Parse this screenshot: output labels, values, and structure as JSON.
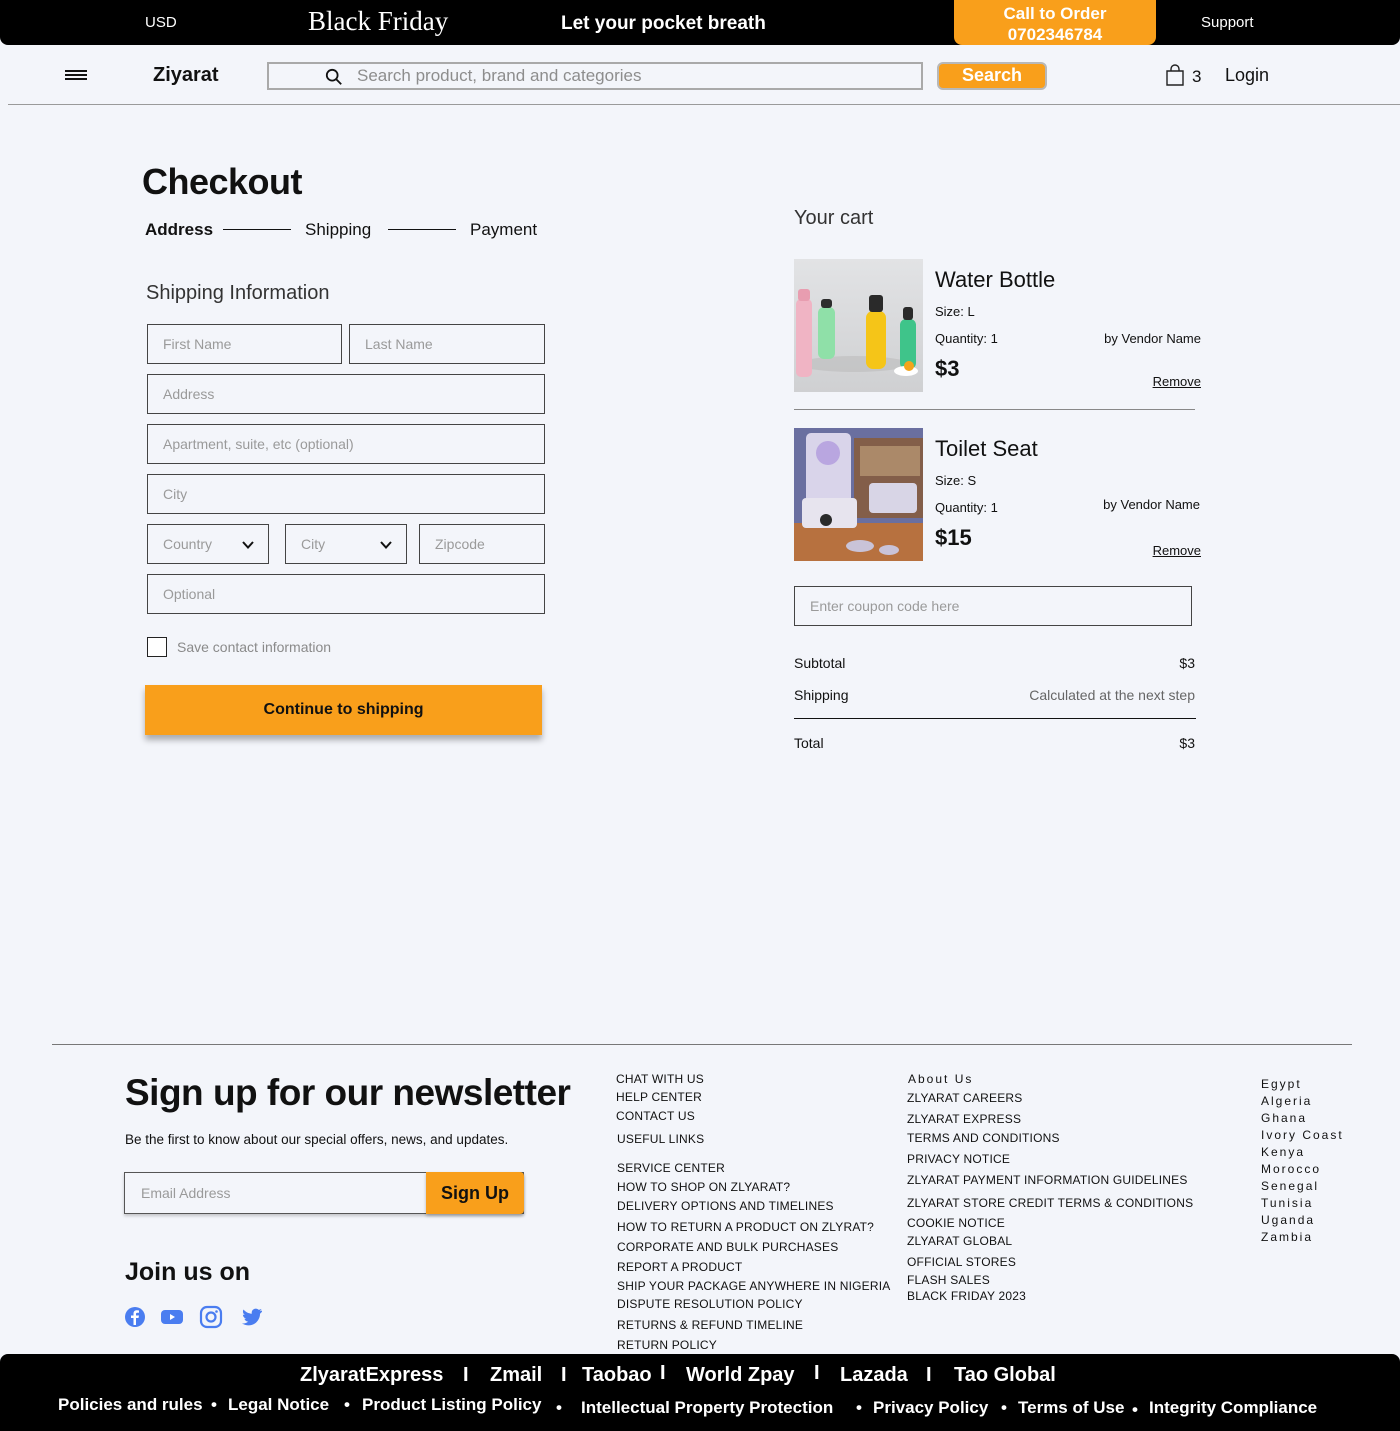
{
  "topbar": {
    "currency": "USD",
    "promo": "Black Friday",
    "tagline": "Let your pocket breath",
    "call_label": "Call to Order",
    "call_number": "0702346784",
    "support": "Support"
  },
  "header": {
    "logo": "Ziyarat",
    "search_placeholder": "Search product, brand and categories",
    "search_button": "Search",
    "cart_count": "3",
    "login": "Login"
  },
  "checkout": {
    "title": "Checkout",
    "steps": [
      "Address",
      "Shipping",
      "Payment"
    ],
    "section_title": "Shipping Information",
    "placeholders": {
      "first_name": "First Name",
      "last_name": "Last Name",
      "address": "Address",
      "apartment": "Apartment, suite, etc (optional)",
      "city": "City",
      "country_select": "Country",
      "city_select": "City",
      "zipcode": "Zipcode",
      "optional": "Optional"
    },
    "save_contact": "Save contact information",
    "continue_button": "Continue to shipping"
  },
  "cart": {
    "title": "Your cart",
    "items": [
      {
        "name": "Water Bottle",
        "size": "Size: L",
        "quantity": "Quantity: 1",
        "vendor": "by Vendor Name",
        "price": "$3",
        "remove": "Remove"
      },
      {
        "name": "Toilet Seat",
        "size": "Size: S",
        "quantity": "Quantity: 1",
        "vendor": "by Vendor Name",
        "price": "$15",
        "remove": "Remove"
      }
    ],
    "coupon_placeholder": "Enter coupon code here",
    "subtotal_label": "Subtotal",
    "subtotal_value": "$3",
    "shipping_label": "Shipping",
    "shipping_value": "Calculated at the next step",
    "total_label": "Total",
    "total_value": "$3"
  },
  "footer": {
    "newsletter_title": "Sign up for our newsletter",
    "newsletter_sub": "Be the first to know about our special offers, news, and updates.",
    "email_placeholder": "Email Address",
    "signup_button": "Sign Up",
    "join_title": "Join us on",
    "social_icons": [
      "facebook-icon",
      "youtube-icon",
      "instagram-icon",
      "twitter-icon"
    ],
    "col1": [
      "CHAT WITH US",
      "HELP CENTER",
      "CONTACT US",
      "USEFUL LINKS",
      "SERVICE CENTER",
      "HOW TO SHOP ON  ZLYARAT?",
      "DELIVERY OPTIONS AND TIMELINES",
      "HOW TO RETURN A PRODUCT ON ZLYRAT?",
      "CORPORATE AND BULK PURCHASES",
      "REPORT A PRODUCT",
      "SHIP YOUR PACKAGE ANYWHERE IN NIGERIA",
      "DISPUTE RESOLUTION POLICY",
      "RETURNS & REFUND TIMELINE",
      "RETURN POLICY"
    ],
    "col2": [
      "About Us",
      "ZLYARAT CAREERS",
      "ZLYARAT EXPRESS",
      "TERMS AND CONDITIONS",
      "PRIVACY NOTICE",
      "ZLYARAT PAYMENT INFORMATION GUIDELINES",
      "ZLYARAT STORE CREDIT TERMS & CONDITIONS",
      "COOKIE NOTICE",
      "ZLYARAT GLOBAL",
      "OFFICIAL STORES",
      "FLASH SALES",
      "BLACK FRIDAY 2023"
    ],
    "countries": [
      "Egypt",
      "Algeria",
      "Ghana",
      "Ivory Coast",
      "Kenya",
      "Morocco",
      "Senegal",
      "Tunisia",
      "Uganda",
      "Zambia"
    ]
  },
  "bottombar": {
    "row1": [
      "ZlyaratExpress",
      "Zmail",
      "Taobao",
      "World Zpay",
      "Lazada",
      "Tao Global"
    ],
    "row1_separator": "I",
    "row2": [
      "Policies and rules",
      "Legal Notice",
      "Product Listing Policy",
      "Intellectual Property Protection",
      "Privacy Policy",
      "Terms of Use",
      "Integrity Compliance"
    ],
    "row2_separator": "•"
  },
  "colors": {
    "accent": "#f99f1b",
    "background": "#f3f5fa",
    "bar": "#000000"
  }
}
